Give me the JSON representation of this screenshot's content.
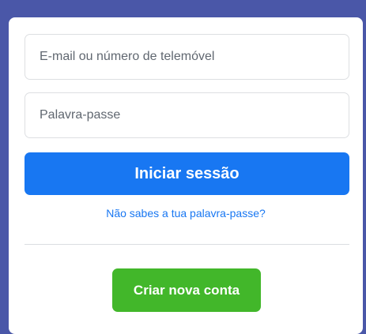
{
  "login_form": {
    "email_placeholder": "E-mail ou número de telemóvel",
    "email_value": "",
    "password_placeholder": "Palavra-passe",
    "password_value": "",
    "login_label": "Iniciar sessão",
    "forgot_password_label": "Não sabes a tua palavra-passe?",
    "create_account_label": "Criar nova conta"
  },
  "colors": {
    "page_background": "#4a57a8",
    "card_background": "#ffffff",
    "primary_blue": "#1877f2",
    "create_green": "#42b72a",
    "border": "#dddfe2"
  }
}
